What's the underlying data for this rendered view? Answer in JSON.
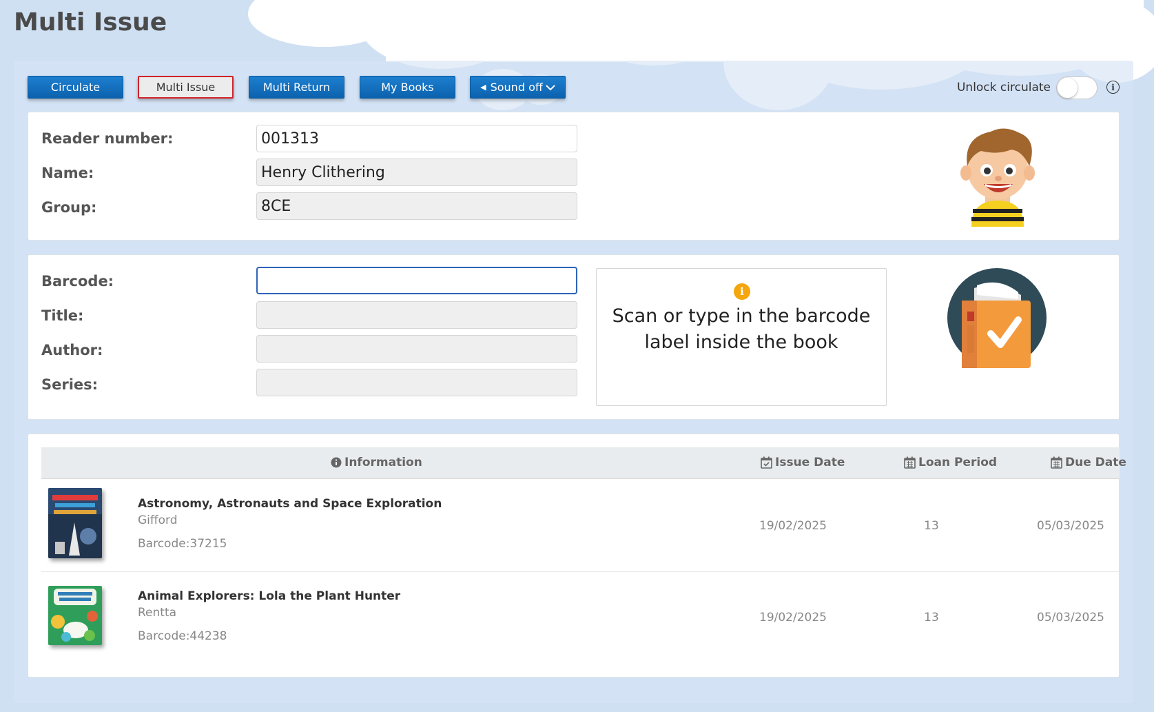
{
  "page": {
    "title": "Multi Issue"
  },
  "toolbar": {
    "buttons": [
      {
        "label": "Circulate",
        "active": false
      },
      {
        "label": "Multi Issue",
        "active": true
      },
      {
        "label": "Multi Return",
        "active": false
      },
      {
        "label": "My Books",
        "active": false
      },
      {
        "label": "Sound off",
        "active": false
      }
    ],
    "unlock_label": "Unlock circulate",
    "unlock_on": false
  },
  "reader": {
    "number_label": "Reader number:",
    "number_value": "001313",
    "name_label": "Name:",
    "name_value": "Henry Clithering",
    "group_label": "Group:",
    "group_value": "8CE"
  },
  "book": {
    "barcode_label": "Barcode:",
    "barcode_value": "",
    "title_label": "Title:",
    "title_value": "",
    "author_label": "Author:",
    "author_value": "",
    "series_label": "Series:",
    "series_value": "",
    "hint": "Scan or type in the barcode label inside the book"
  },
  "loans": {
    "headers": {
      "information": "Information",
      "issue_date": "Issue Date",
      "loan_period": "Loan Period",
      "due_date": "Due Date"
    },
    "rows": [
      {
        "title": "Astronomy, Astronauts and Space Exploration",
        "author": "Gifford",
        "barcode": "Barcode:37215",
        "issue_date": "19/02/2025",
        "loan_period": "13",
        "due_date": "05/03/2025"
      },
      {
        "title": "Animal Explorers: Lola the Plant Hunter",
        "author": "Rentta",
        "barcode": "Barcode:44238",
        "issue_date": "19/02/2025",
        "loan_period": "13",
        "due_date": "05/03/2025"
      }
    ]
  },
  "colors": {
    "primary_button": "#1a78c8",
    "active_border": "#d0232a",
    "focus_border": "#2e64b8",
    "info_yellow": "#f4a60c"
  },
  "icons": {
    "speaker": "speaker-icon",
    "chevron": "chevron-down-icon",
    "info": "info-icon",
    "calendar": "calendar-icon"
  }
}
